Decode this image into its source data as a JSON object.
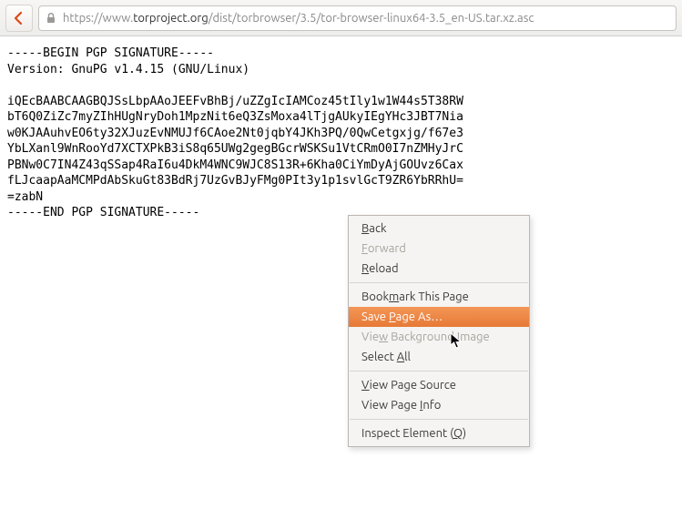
{
  "url": {
    "scheme": "https://www.",
    "host": "torproject.org",
    "path": "/dist/torbrowser/3.5/tor-browser-linux64-3.5_en-US.tar.xz.asc"
  },
  "pgp": {
    "begin": "-----BEGIN PGP SIGNATURE-----",
    "version": "Version: GnuPG v1.4.15 (GNU/Linux)",
    "lines": [
      "iQEcBAABCAAGBQJSsLbpAAoJEEFvBhBj/uZZgIcIAMCoz45tIly1w1W44s5T38RW",
      "bT6Q0ZiZc7myZIhHUgNryDoh1MpzNit6eQ3ZsMoxa4lTjgAUkyIEgYHc3JBT7Nia",
      "w0KJAAuhvEO6ty32XJuzEvNMUJf6CAoe2Nt0jqbY4JKh3PQ/0QwCetgxjg/f67e3",
      "YbLXanl9WnRooYd7XCTXPkB3iS8q65UWg2gegBGcrWSKSu1VtCRmO0I7nZMHyJrC",
      "PBNw0C7IN4Z43qSSap4RaI6u4DkM4WNC9WJC8S13R+6Kha0CiYmDyAjGOUvz6Cax",
      "fLJcaapAaMCMPdAbSkuGt83BdRj7UzGvBJyFMg0PIt3y1p1svlGcT9ZR6YbRRhU="
    ],
    "tail": "=zabN",
    "end": "-----END PGP SIGNATURE-----"
  },
  "menu": {
    "back": "Back",
    "forward": "Forward",
    "reload": "Reload",
    "bookmark": "Bookmark This Page",
    "save_as": "Save Page As…",
    "view_bg": "View Background Image",
    "select_all": "Select All",
    "view_source": "View Page Source",
    "view_info": "View Page Info",
    "inspect": "Inspect Element (Q)"
  }
}
